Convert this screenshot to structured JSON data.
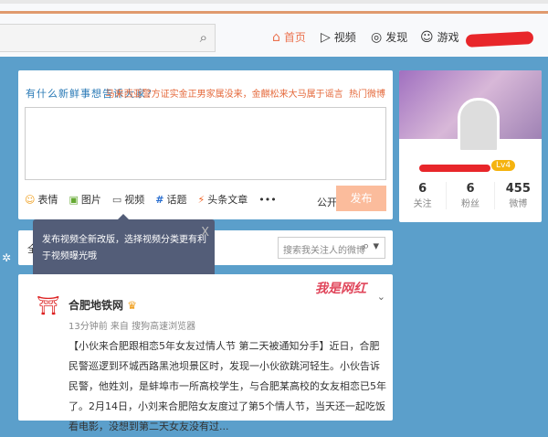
{
  "header": {
    "nav": [
      {
        "label": "首页",
        "icon": "home-icon",
        "active": true
      },
      {
        "label": "视频",
        "icon": "video-icon"
      },
      {
        "label": "发现",
        "icon": "compass-icon"
      },
      {
        "label": "游戏",
        "icon": "gamepad-icon"
      }
    ]
  },
  "composer": {
    "prompt": "有什么新鲜事想告诉大家？",
    "hot_topic": "马来西亚警方证实金正男家属没来，金麒松来大马属于谣言",
    "hot_label": "热门微博",
    "tools": [
      {
        "label": "表情",
        "icon": "smile-icon"
      },
      {
        "label": "图片",
        "icon": "image-icon"
      },
      {
        "label": "视频",
        "icon": "video-icon"
      },
      {
        "label": "话题",
        "icon": "hashtag-icon"
      },
      {
        "label": "头条文章",
        "icon": "lightning-icon"
      }
    ],
    "more": "•••",
    "visibility": "公开",
    "post_label": "发布"
  },
  "tooltip": {
    "text": "发布视频全新改版，选择视频分类更有利于视频曝光哦",
    "close": "X"
  },
  "filter": {
    "label": "全",
    "search_placeholder": "搜索我关注人的微博"
  },
  "profile": {
    "level": "Lv4",
    "stats": [
      {
        "value": "6",
        "label": "关注"
      },
      {
        "value": "6",
        "label": "粉丝"
      },
      {
        "value": "455",
        "label": "微博"
      }
    ]
  },
  "feed": {
    "author": "合肥地铁网",
    "badge": "我是网红",
    "meta": "13分钟前 来自 搜狗高速浏览器",
    "text": "【小伙来合肥跟相恋5年女友过情人节 第二天被通知分手】近日，合肥民警巡逻到环城西路黑池坝景区时，发现一小伙欲跳河轻生。小伙告诉民警，他姓刘，是蚌埠市一所高校学生，与合肥某高校的女友相恋已5年了。2月14日，小刘来合肥陪女友度过了第5个情人节，当天还一起吃饭看电影，没想到第二天女友没有过..."
  },
  "colors": {
    "accent": "#eb7350",
    "background": "#5b9fcb",
    "tooltip": "#535d78"
  }
}
